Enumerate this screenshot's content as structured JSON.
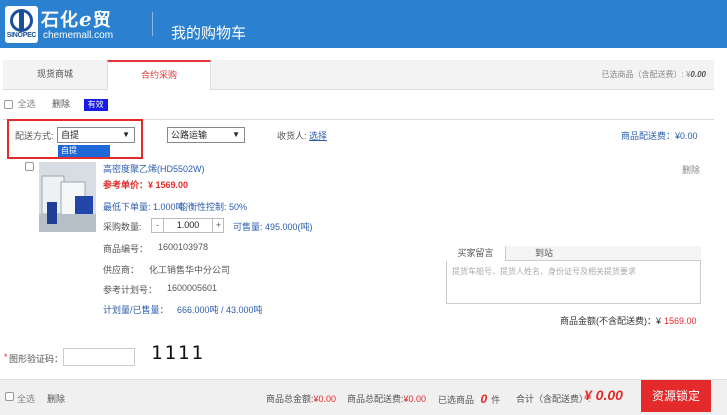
{
  "header": {
    "logo_sub": "SINOPEC",
    "brand_text": "石化",
    "brand_e": "e",
    "brand_suffix": "贸",
    "domain": "chememall.com",
    "title": "我的购物车"
  },
  "tabs": [
    {
      "label": "现货商城"
    },
    {
      "label": "合约采购"
    }
  ],
  "selected_info": {
    "prefix": "已选商品（含配送费）: ¥",
    "value": "0.00"
  },
  "toolbar": {
    "select_all": "全选",
    "delete": "删除",
    "valid_badge": "有效"
  },
  "shipping": {
    "method_label": "配送方式:",
    "method_value": "自提",
    "transport_value": "公路运输",
    "receiver_label": "收货人:",
    "receiver_link": "选择",
    "fee_label": "商品配送费：¥",
    "fee_value": "0.00",
    "dropdown_option": "自提"
  },
  "product": {
    "name": "高密度聚乙烯(HD5502W)",
    "delete": "删除",
    "ref_price_label": "参考单价：",
    "ref_price": "¥ 1569.00",
    "min_order": "最低下单量: 1.000吨",
    "balance": "均衡性控制: 50%",
    "qty_label": "采购数量:",
    "qty_minus": "-",
    "qty_value": "1.000",
    "qty_plus": "+",
    "available": "可售量: 495.000(吨)",
    "code_label": "商品编号：",
    "code_value": "1600103978",
    "supplier_label": "供应商：",
    "supplier_value": "化工销售华中分公司",
    "plan_label": "参考计划号：",
    "plan_value": "1600005601",
    "plan_sold_label": "计划量/已售量：",
    "plan_sold_value": "666.000吨 / 43.000吨",
    "msg_tab1": "买家留言",
    "msg_tab2": "到站",
    "msg_placeholder": "提货车船号、提货人姓名、身份证号及相关提货要求",
    "amount_label": "商品金额(不含配送费)：¥",
    "amount_value": "1569.00"
  },
  "captcha": {
    "label": "图形验证码：",
    "code": "1111",
    "input_value": ""
  },
  "footer": {
    "select_all": "全选",
    "delete": "删除",
    "total_label": "商品总金额:",
    "total_value": "¥0.00",
    "fee_label": "商品总配送费:",
    "fee_value": "¥0.00",
    "selected_label": "已选商品",
    "selected_count": "0",
    "selected_unit": "件",
    "sum_label": "合计（含配送费）:",
    "sum_value": "¥ 0.00",
    "lock_button": "资源锁定"
  },
  "colors": {
    "header_blue": "#2b80cf",
    "accent_red": "#e42a2a",
    "link_blue": "#2a5db0"
  }
}
